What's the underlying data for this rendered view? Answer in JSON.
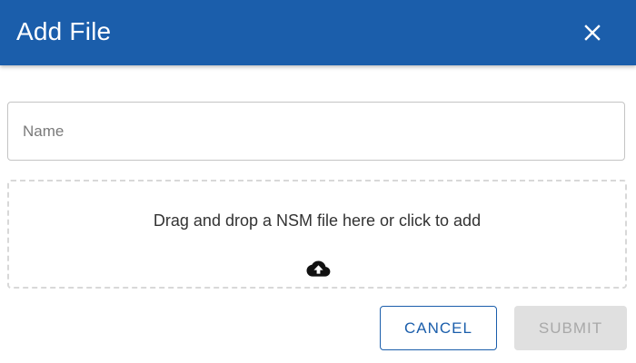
{
  "dialog": {
    "title": "Add File",
    "header_color": "#1b5eab",
    "close_icon": "close-icon"
  },
  "form": {
    "name_placeholder": "Name",
    "name_value": ""
  },
  "dropzone": {
    "text": "Drag and drop a NSM file here or click to add",
    "icon": "cloud-upload-icon"
  },
  "actions": {
    "cancel_label": "CANCEL",
    "submit_label": "SUBMIT",
    "submit_disabled": true
  }
}
